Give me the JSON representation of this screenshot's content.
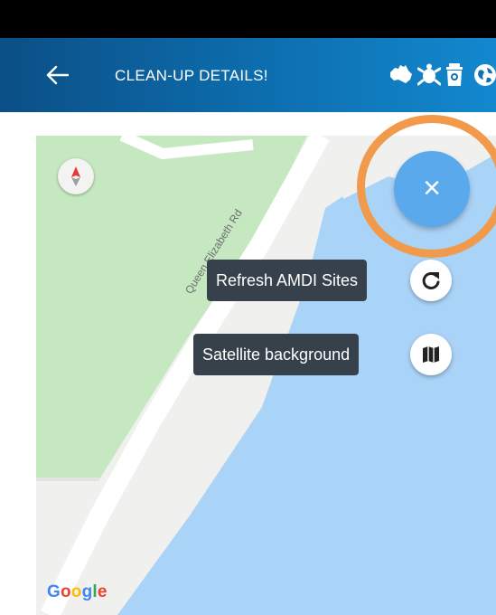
{
  "header": {
    "title": "CLEAN-UP DETAILS!",
    "icons": [
      "back-arrow-icon",
      "australia-map-icon",
      "turtle-icon",
      "bin-icon",
      "globe-icon"
    ]
  },
  "map": {
    "road_label": "Queen Elizabeth Rd",
    "attribution": [
      "G",
      "o",
      "o",
      "g",
      "l",
      "e"
    ],
    "compass_icon": "compass-icon"
  },
  "fab": {
    "close_label": "×",
    "actions": [
      {
        "label": "Refresh AMDI Sites",
        "icon": "refresh-icon"
      },
      {
        "label": "Satellite background",
        "icon": "map-icon"
      }
    ]
  },
  "colors": {
    "header_start": "#0b4f86",
    "header_end": "#1388cf",
    "fab": "#5aa9ec",
    "highlight": "#f29a4b",
    "water": "#aad3f8",
    "park": "#c5e8c1"
  }
}
